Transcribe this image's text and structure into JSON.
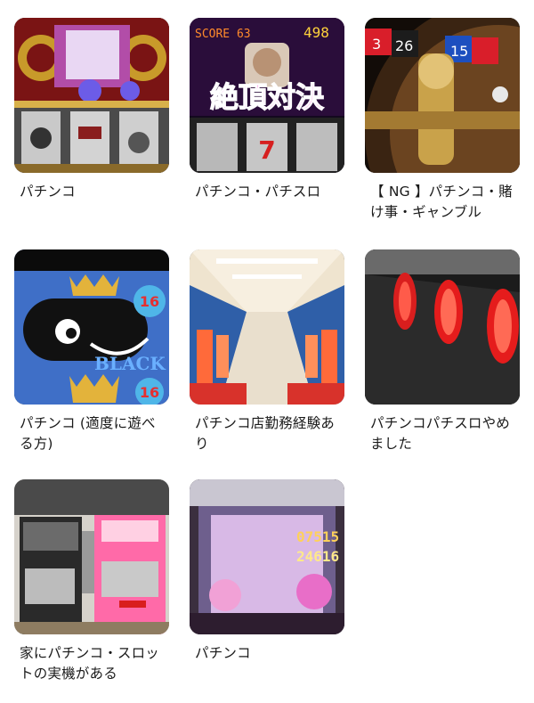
{
  "communities": [
    {
      "id": "c1",
      "label": "パチンコ",
      "image": "slot-machine-reels-icon"
    },
    {
      "id": "c2",
      "label": "パチンコ・パチスロ",
      "image": "slot-machine-zetcho-icon"
    },
    {
      "id": "c3",
      "label": "【 NG 】パチンコ・賭け事・ギャンブル",
      "image": "roulette-wheel-icon"
    },
    {
      "id": "c4",
      "label": "パチンコ (適度に遊べる方)",
      "image": "black-cat-character-icon"
    },
    {
      "id": "c5",
      "label": "パチンコ店勤務経験あり",
      "image": "pachinko-parlor-aisle-icon"
    },
    {
      "id": "c6",
      "label": "パチンコパチスロやめました",
      "image": "slot-stop-buttons-icon"
    },
    {
      "id": "c7",
      "label": "家にパチンコ・スロットの実機がある",
      "image": "home-slot-machines-icon"
    },
    {
      "id": "c8",
      "label": "パチンコ",
      "image": "pachinko-screen-icon"
    }
  ],
  "texts": {
    "zetcho": "絶頂対決",
    "score": "498",
    "r1": "3",
    "r2": "26",
    "r3": "15",
    "n16a": "16",
    "n16b": "16",
    "black": "BLACK",
    "t07515": "07515",
    "t24616": "24616"
  }
}
